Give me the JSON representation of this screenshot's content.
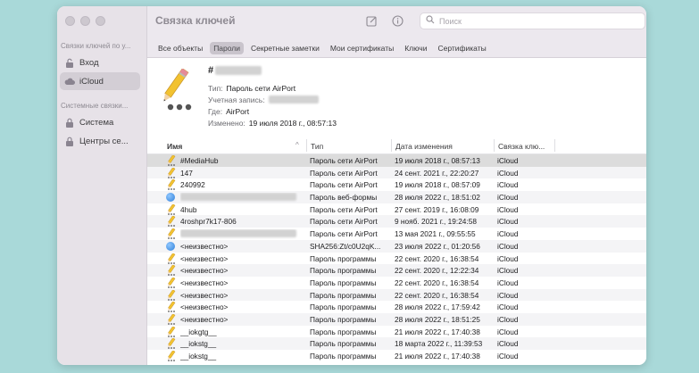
{
  "window": {
    "title": "Связка ключей",
    "search_placeholder": "Поиск"
  },
  "sidebar": {
    "section1": "Связки ключей по у...",
    "items1": [
      {
        "label": "Вход",
        "icon": "lock-open-icon"
      },
      {
        "label": "iCloud",
        "icon": "cloud-icon",
        "selected": true
      }
    ],
    "section2": "Системные связки...",
    "items2": [
      {
        "label": "Система",
        "icon": "lock-icon"
      },
      {
        "label": "Центры се...",
        "icon": "lock-icon"
      }
    ]
  },
  "tabs": [
    {
      "label": "Все объекты"
    },
    {
      "label": "Пароли",
      "active": true
    },
    {
      "label": "Секретные заметки"
    },
    {
      "label": "Мои сертификаты"
    },
    {
      "label": "Ключи"
    },
    {
      "label": "Сертификаты"
    }
  ],
  "detail": {
    "name_prefix": "#",
    "type_label": "Тип:",
    "type_value": "Пароль сети AirPort",
    "account_label": "Учетная запись:",
    "where_label": "Где:",
    "where_value": "AirPort",
    "modified_label": "Изменено:",
    "modified_value": "19 июля 2018 г., 08:57:13"
  },
  "table": {
    "headers": {
      "name": "Имя",
      "type": "Тип",
      "date": "Дата изменения",
      "keychain": "Связка клю..."
    },
    "rows": [
      {
        "name": "#MediaHub",
        "type": "Пароль сети AirPort",
        "date": "19 июля 2018 г., 08:57:13",
        "keychain": "iCloud",
        "icon": "pencil",
        "selected": true
      },
      {
        "name": "147",
        "type": "Пароль сети AirPort",
        "date": "24 сент. 2021 г., 22:20:27",
        "keychain": "iCloud",
        "icon": "pencil"
      },
      {
        "name": "240992",
        "type": "Пароль сети AirPort",
        "date": "19 июля 2018 г., 08:57:09",
        "keychain": "iCloud",
        "icon": "pencil"
      },
      {
        "name": "",
        "type": "Пароль веб-формы",
        "date": "28 июля 2022 г., 18:51:02",
        "keychain": "iCloud",
        "icon": "globe",
        "blurred": true
      },
      {
        "name": "4hub",
        "type": "Пароль сети AirPort",
        "date": "27 сент. 2019 г., 16:08:09",
        "keychain": "iCloud",
        "icon": "pencil"
      },
      {
        "name": "4roshpr7k17-806",
        "type": "Пароль сети AirPort",
        "date": "9 нояб. 2021 г., 19:24:58",
        "keychain": "iCloud",
        "icon": "pencil"
      },
      {
        "name": "",
        "type": "Пароль сети AirPort",
        "date": "13 мая 2021 г., 09:55:55",
        "keychain": "iCloud",
        "icon": "pencil",
        "blurred": true
      },
      {
        "name": "<неизвестно>",
        "type": "SHA256:Zt/c0U2qK...",
        "date": "23 июля 2022 г., 01:20:56",
        "keychain": "iCloud",
        "icon": "globe"
      },
      {
        "name": "<неизвестно>",
        "type": "Пароль программы",
        "date": "22 сент. 2020 г., 16:38:54",
        "keychain": "iCloud",
        "icon": "pencil"
      },
      {
        "name": "<неизвестно>",
        "type": "Пароль программы",
        "date": "22 сент. 2020 г., 12:22:34",
        "keychain": "iCloud",
        "icon": "pencil"
      },
      {
        "name": "<неизвестно>",
        "type": "Пароль программы",
        "date": "22 сент. 2020 г., 16:38:54",
        "keychain": "iCloud",
        "icon": "pencil"
      },
      {
        "name": "<неизвестно>",
        "type": "Пароль программы",
        "date": "22 сент. 2020 г., 16:38:54",
        "keychain": "iCloud",
        "icon": "pencil"
      },
      {
        "name": "<неизвестно>",
        "type": "Пароль программы",
        "date": "28 июля 2022 г., 17:59:42",
        "keychain": "iCloud",
        "icon": "pencil"
      },
      {
        "name": "<неизвестно>",
        "type": "Пароль программы",
        "date": "28 июля 2022 г., 18:51:25",
        "keychain": "iCloud",
        "icon": "pencil"
      },
      {
        "name": "__iokgtg__",
        "type": "Пароль программы",
        "date": "21 июля 2022 г., 17:40:38",
        "keychain": "iCloud",
        "icon": "pencil"
      },
      {
        "name": "__iokstg__",
        "type": "Пароль программы",
        "date": "18 марта 2022 г., 11:39:53",
        "keychain": "iCloud",
        "icon": "pencil"
      },
      {
        "name": "__iokstg__",
        "type": "Пароль программы",
        "date": "21 июля 2022 г., 17:40:38",
        "keychain": "iCloud",
        "icon": "pencil"
      }
    ]
  }
}
